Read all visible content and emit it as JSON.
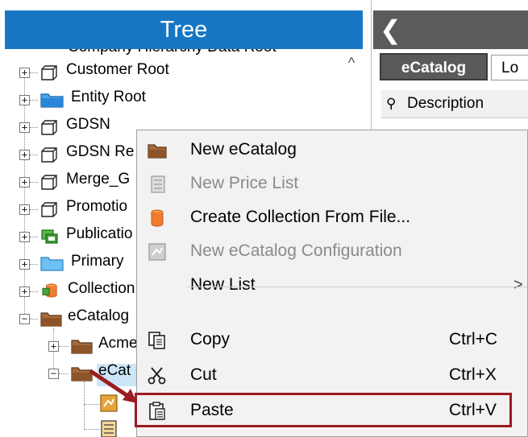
{
  "tree": {
    "title": "Tree",
    "partial_top_label": "Company Hierarchy Data Root",
    "items": [
      {
        "label": "Customer Root"
      },
      {
        "label": "Entity Root"
      },
      {
        "label": "GDSN"
      },
      {
        "label": "GDSN Re"
      },
      {
        "label": "Merge_G"
      },
      {
        "label": "Promotio"
      },
      {
        "label": "Publicatio"
      },
      {
        "label": "Primary"
      },
      {
        "label": "Collection"
      },
      {
        "label": "eCatalog"
      },
      {
        "label": "Acme"
      },
      {
        "label": "eCat"
      }
    ]
  },
  "right_pane": {
    "tabs": [
      {
        "label": "eCatalog"
      },
      {
        "label": "Lo"
      }
    ],
    "column_header": "Description"
  },
  "context_menu": {
    "items": [
      {
        "label": "New eCatalog",
        "enabled": true,
        "icon": "folder-icon"
      },
      {
        "label": "New Price List",
        "enabled": false,
        "icon": "price-list-icon"
      },
      {
        "label": "Create Collection From File...",
        "enabled": true,
        "icon": "collection-icon"
      },
      {
        "label": "New eCatalog Configuration",
        "enabled": false,
        "icon": "configuration-icon"
      },
      {
        "label": "New List",
        "enabled": true,
        "submenu_arrow": ">"
      },
      {
        "label": "Copy",
        "shortcut": "Ctrl+C",
        "enabled": true,
        "icon": "copy-icon"
      },
      {
        "label": "Cut",
        "shortcut": "Ctrl+X",
        "enabled": true,
        "icon": "scissors-icon"
      },
      {
        "label": "Paste",
        "shortcut": "Ctrl+V",
        "enabled": true,
        "icon": "clipboard-icon"
      }
    ]
  },
  "colors": {
    "tree_header": "#1777c5",
    "right_header": "#5b5b5b",
    "menu_background": "#f2f2f2",
    "disabled_text": "#8a8a8a",
    "highlight": "#9b1c22"
  }
}
